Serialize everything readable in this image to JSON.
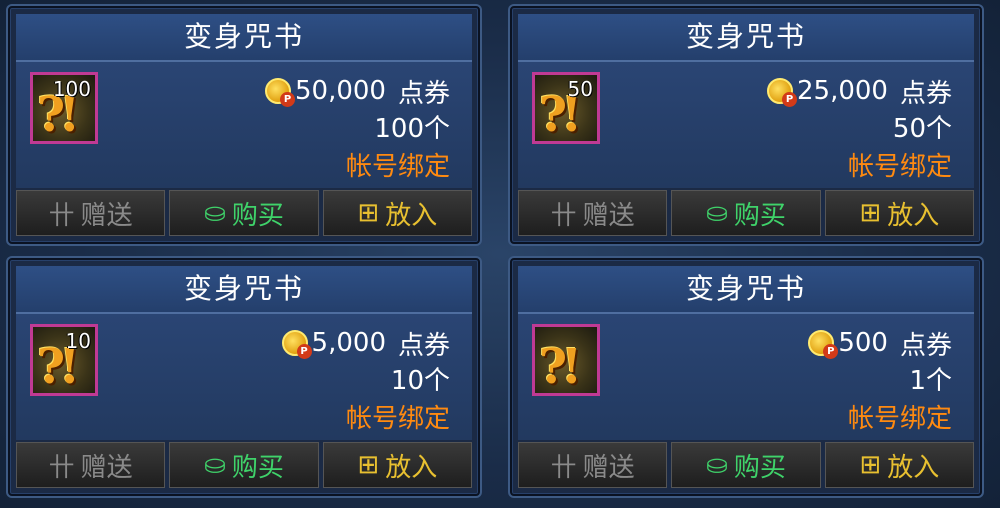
{
  "items": [
    {
      "title": "变身咒书",
      "qty_badge": "100",
      "price": "50,000",
      "currency": "点券",
      "count": "100个",
      "binding": "帐号绑定"
    },
    {
      "title": "变身咒书",
      "qty_badge": "50",
      "price": "25,000",
      "currency": "点券",
      "count": "50个",
      "binding": "帐号绑定"
    },
    {
      "title": "变身咒书",
      "qty_badge": "10",
      "price": "5,000",
      "currency": "点券",
      "count": "10个",
      "binding": "帐号绑定"
    },
    {
      "title": "变身咒书",
      "qty_badge": "",
      "price": "500",
      "currency": "点券",
      "count": "1个",
      "binding": "帐号绑定"
    }
  ],
  "buttons": {
    "gift": "赠送",
    "buy": "购买",
    "cart": "放入"
  },
  "colors": {
    "binding": "#ff8a10",
    "buy": "#3fd36a",
    "cart": "#e8c030",
    "gift": "#8a8a8a",
    "icon_border": "#c03a94"
  },
  "icons": {
    "item": "transformation-scroll-icon",
    "coin": "point-coin-icon",
    "gift": "gift-icon",
    "buy": "buy-icon",
    "cart": "cart-icon"
  }
}
